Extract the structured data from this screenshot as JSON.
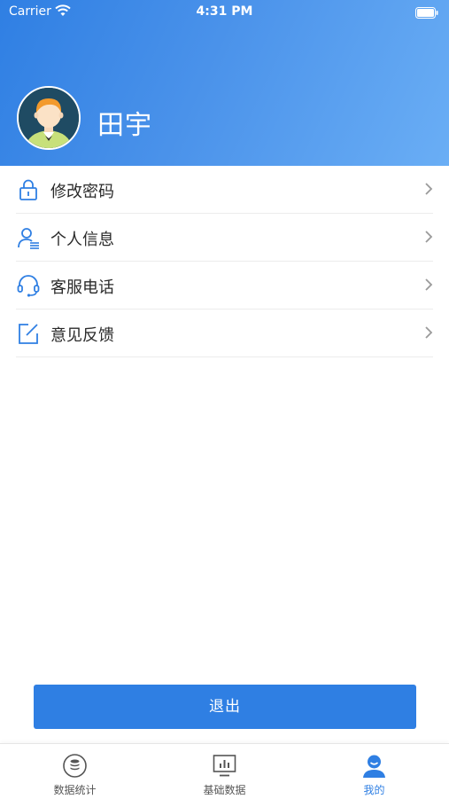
{
  "status_bar": {
    "carrier": "Carrier",
    "time": "4:31 PM"
  },
  "profile": {
    "name": "田宇"
  },
  "menu": {
    "items": [
      {
        "label": "修改密码",
        "icon": "lock-icon"
      },
      {
        "label": "个人信息",
        "icon": "person-info-icon"
      },
      {
        "label": "客服电话",
        "icon": "headset-icon"
      },
      {
        "label": "意见反馈",
        "icon": "edit-feedback-icon"
      }
    ]
  },
  "logout": {
    "label": "退出"
  },
  "tab_bar": {
    "tabs": [
      {
        "label": "数据统计",
        "icon": "database-icon",
        "active": false
      },
      {
        "label": "基础数据",
        "icon": "monitor-chart-icon",
        "active": false
      },
      {
        "label": "我的",
        "icon": "user-profile-icon",
        "active": true
      }
    ]
  },
  "colors": {
    "primary": "#2f7fe3",
    "header_gradient_end": "#6aaef5",
    "text": "#2a2a2a",
    "divider": "#ececec"
  }
}
